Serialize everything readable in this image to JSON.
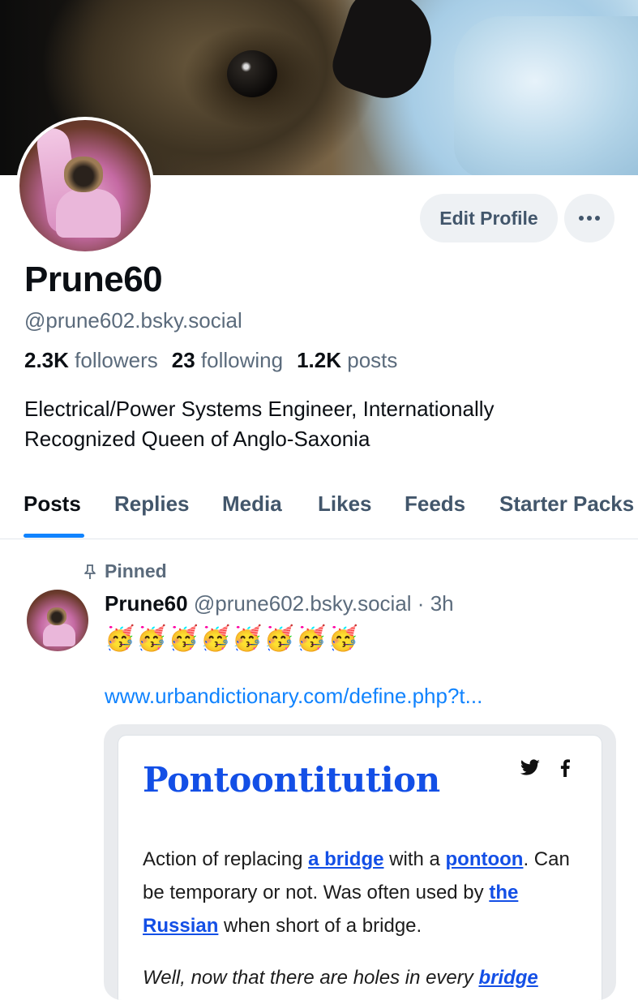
{
  "profile": {
    "display_name": "Prune60",
    "handle": "@prune602.bsky.social",
    "followers_count": "2.3K",
    "followers_label": "followers",
    "following_count": "23",
    "following_label": "following",
    "posts_count": "1.2K",
    "posts_label": "posts",
    "bio": "Electrical/Power Systems Engineer, Internationally Recognized Queen of Anglo-Saxonia"
  },
  "actions": {
    "edit_profile_label": "Edit Profile",
    "more_icon": "ellipsis-icon"
  },
  "tabs": [
    {
      "label": "Posts",
      "active": true
    },
    {
      "label": "Replies",
      "active": false
    },
    {
      "label": "Media",
      "active": false
    },
    {
      "label": "Likes",
      "active": false
    },
    {
      "label": "Feeds",
      "active": false
    },
    {
      "label": "Starter Packs",
      "active": false
    }
  ],
  "pinned_post": {
    "pinned_label": "Pinned",
    "author_name": "Prune60",
    "author_handle": "@prune602.bsky.social",
    "separator": " · ",
    "time": "3h",
    "emojis": "🥳🥳🥳🥳🥳🥳🥳🥳",
    "link_text": "www.urbandictionary.com/define.php?t...",
    "embed": {
      "title": "Pontoontitution",
      "def_part1": "Action of replacing ",
      "def_link1": "a bridge",
      "def_part2": " with a ",
      "def_link2": "pontoon",
      "def_part3": ". Can be temporary or not. Was often used by ",
      "def_link3": "the Russian",
      "def_part4": " when short of a bridge.",
      "example_part1": "Well, now that there are holes in every ",
      "example_link1": "bridge"
    }
  },
  "colors": {
    "accent": "#1083fe",
    "ud_blue": "#134fe6",
    "muted_text": "#5b6b7c",
    "button_bg": "#eef1f4"
  }
}
